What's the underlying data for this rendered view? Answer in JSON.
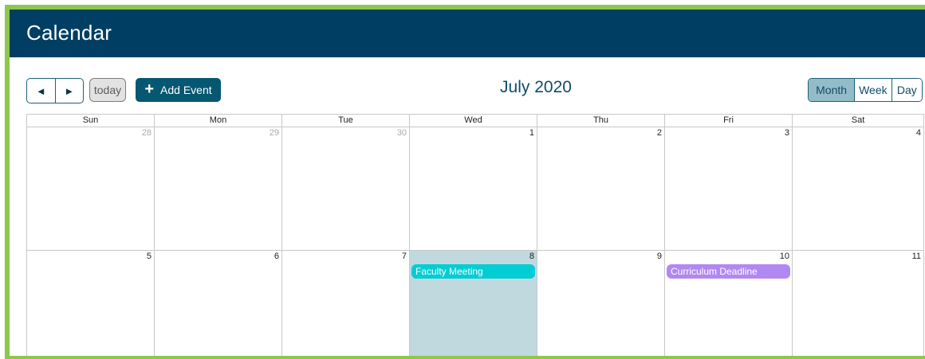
{
  "app": {
    "title": "Calendar"
  },
  "toolbar": {
    "prev_label": "◄",
    "next_label": "►",
    "today_label": "today",
    "add_event_icon": "plus-icon",
    "add_event_label": "Add Event",
    "month_title": "July 2020",
    "views": [
      "Month",
      "Week",
      "Day"
    ],
    "active_view": "Month"
  },
  "calendar": {
    "weekdays": [
      "Sun",
      "Mon",
      "Tue",
      "Wed",
      "Thu",
      "Fri",
      "Sat"
    ],
    "weeks": [
      [
        {
          "day": "28",
          "other": true
        },
        {
          "day": "29",
          "other": true
        },
        {
          "day": "30",
          "other": true
        },
        {
          "day": "1"
        },
        {
          "day": "2"
        },
        {
          "day": "3"
        },
        {
          "day": "4"
        }
      ],
      [
        {
          "day": "5"
        },
        {
          "day": "6"
        },
        {
          "day": "7"
        },
        {
          "day": "8",
          "today": true,
          "event": {
            "title": "Faculty Meeting",
            "color": "#00cdd4"
          }
        },
        {
          "day": "9"
        },
        {
          "day": "10",
          "event": {
            "title": "Curriculum Deadline",
            "color": "#b188f2"
          }
        },
        {
          "day": "11"
        }
      ]
    ]
  },
  "colors": {
    "header_bg": "#003f63",
    "frame": "#8cc84b",
    "today_bg": "#c0d9df",
    "add_button_bg": "#065772",
    "active_view_bg": "#94bcc8"
  }
}
